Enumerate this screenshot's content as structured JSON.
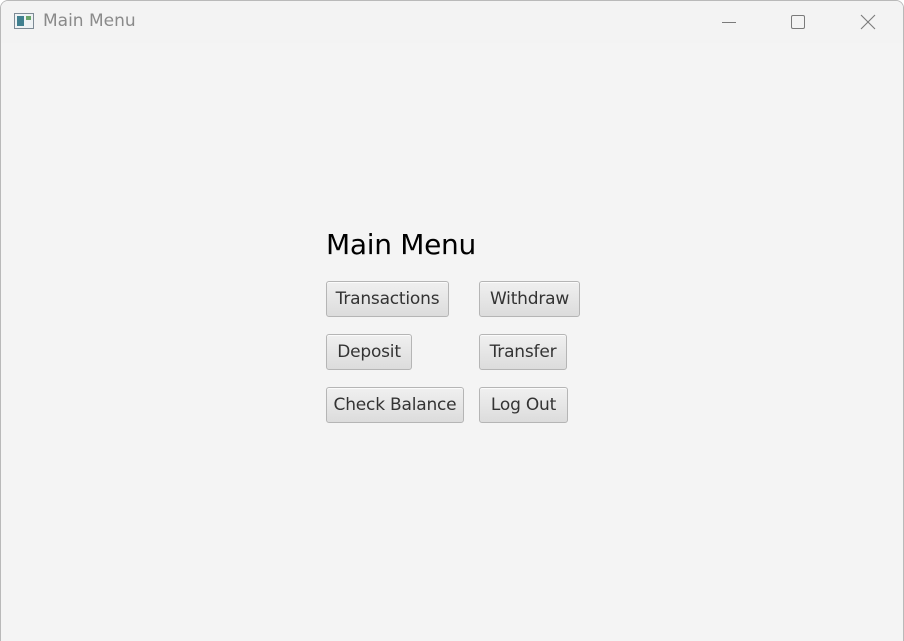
{
  "window": {
    "title": "Main Menu",
    "icon": "app-window-icon",
    "controls": {
      "minimize_icon": "minimize-icon",
      "maximize_icon": "maximize-icon",
      "close_icon": "close-icon"
    }
  },
  "main": {
    "heading": "Main Menu",
    "buttons": {
      "transactions": "Transactions",
      "withdraw": "Withdraw",
      "deposit": "Deposit",
      "transfer": "Transfer",
      "check_balance": "Check Balance",
      "log_out": "Log Out"
    }
  },
  "colors": {
    "background": "#f4f4f4",
    "button_top": "#f0f0f0",
    "button_bottom": "#dcdcdc",
    "button_border": "#b5b5b5",
    "text": "#333333",
    "title_text": "#8a8a8a"
  }
}
